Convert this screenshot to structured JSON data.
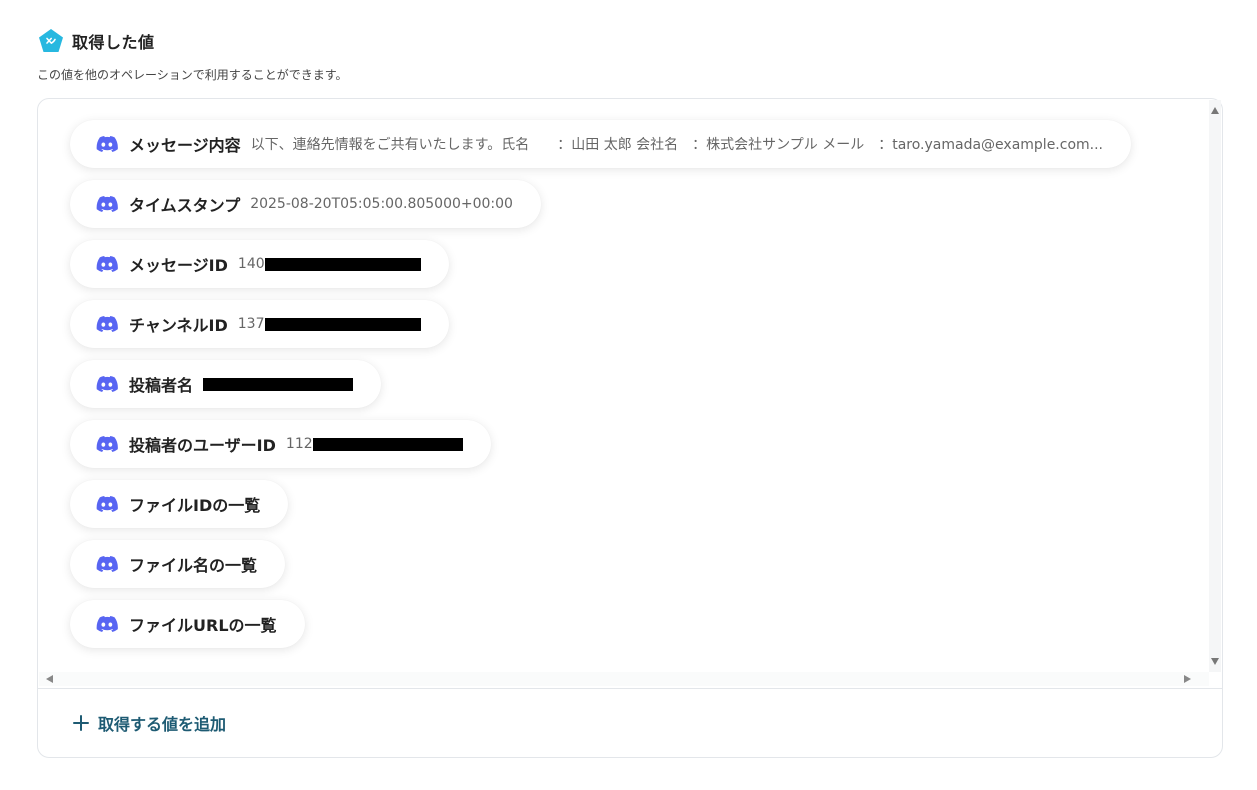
{
  "header": {
    "title": "取得した値",
    "subtitle": "この値を他のオペレーションで利用することができます。"
  },
  "items": [
    {
      "label": "メッセージ内容",
      "value": "以下、連絡先情報をご共有いたします。氏名　　：山田 太郎 会社名　：株式会社サンプル メール　：taro.yamada@example.com..."
    },
    {
      "label": "タイムスタンプ",
      "value": "2025-08-20T05:05:00.805000+00:00"
    },
    {
      "label": "メッセージID",
      "value": "140"
    },
    {
      "label": "チャンネルID",
      "value": "137"
    },
    {
      "label": "投稿者名",
      "value": ""
    },
    {
      "label": "投稿者のユーザーID",
      "value": "112"
    },
    {
      "label": "ファイルIDの一覧",
      "value": ""
    },
    {
      "label": "ファイル名の一覧",
      "value": ""
    },
    {
      "label": "ファイルURLの一覧",
      "value": ""
    }
  ],
  "actions": {
    "add_label": "取得する値を追加"
  },
  "colors": {
    "discord": "#5865F2",
    "accent": "#1e5b73",
    "header_icon": "#27b8e0"
  },
  "icons": {
    "header": "yoom-pentagon-icon",
    "item": "discord-icon",
    "add": "plus-icon"
  }
}
